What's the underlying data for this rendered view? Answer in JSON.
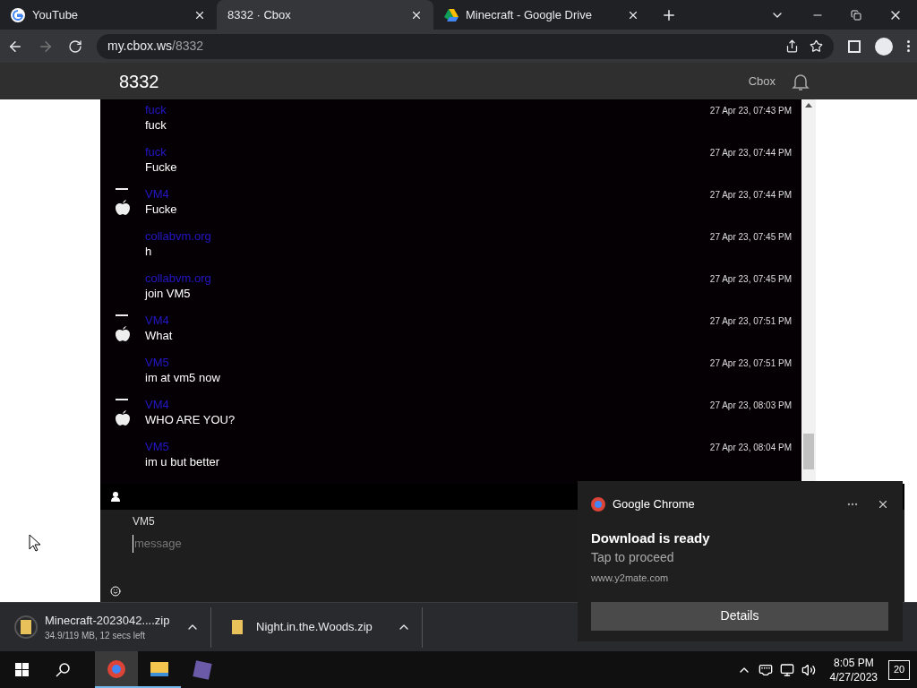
{
  "browser": {
    "tabs": [
      {
        "title": "YouTube",
        "kind": "google",
        "selected": false
      },
      {
        "title": "8332 · Cbox",
        "kind": "none",
        "selected": true
      },
      {
        "title": "Minecraft - Google Drive",
        "kind": "drive",
        "selected": false
      }
    ],
    "address": {
      "host": "my.cbox.ws",
      "path": "/8332"
    }
  },
  "header": {
    "title": "8332",
    "brand": "Cbox"
  },
  "messages": [
    {
      "name": "fuck",
      "text": "fuck",
      "time": "27 Apr 23, 07:43 PM",
      "avatar": false
    },
    {
      "name": "fuck",
      "text": "Fucke",
      "time": "27 Apr 23, 07:44 PM",
      "avatar": false
    },
    {
      "name": "VM4",
      "text": "Fucke",
      "time": "27 Apr 23, 07:44 PM",
      "avatar": true
    },
    {
      "name": "collabvm.org",
      "text": "h",
      "time": "27 Apr 23, 07:45 PM",
      "avatar": false
    },
    {
      "name": "collabvm.org",
      "text": "join VM5",
      "time": "27 Apr 23, 07:45 PM",
      "avatar": false
    },
    {
      "name": "VM4",
      "text": "What",
      "time": "27 Apr 23, 07:51 PM",
      "avatar": true
    },
    {
      "name": "VM5",
      "text": "im at vm5 now",
      "time": "27 Apr 23, 07:51 PM",
      "avatar": false
    },
    {
      "name": "VM4",
      "text": "WHO ARE YOU?",
      "time": "27 Apr 23, 08:03 PM",
      "avatar": true
    },
    {
      "name": "VM5",
      "text": "im u but better",
      "time": "27 Apr 23, 08:04 PM",
      "avatar": false
    }
  ],
  "composer": {
    "user": "VM5",
    "placeholder": "message"
  },
  "notification": {
    "app": "Google Chrome",
    "title": "Download is ready",
    "subtitle": "Tap to proceed",
    "source": "www.y2mate.com",
    "button": "Details"
  },
  "downloads": [
    {
      "name": "Minecraft-2023042....zip",
      "status": "34.9/119 MB, 12 secs left",
      "in_progress": true
    },
    {
      "name": "Night.in.the.Woods.zip",
      "in_progress": false
    }
  ],
  "taskbar": {
    "time": "8:05 PM",
    "date": "4/27/2023",
    "notifications": "20"
  }
}
